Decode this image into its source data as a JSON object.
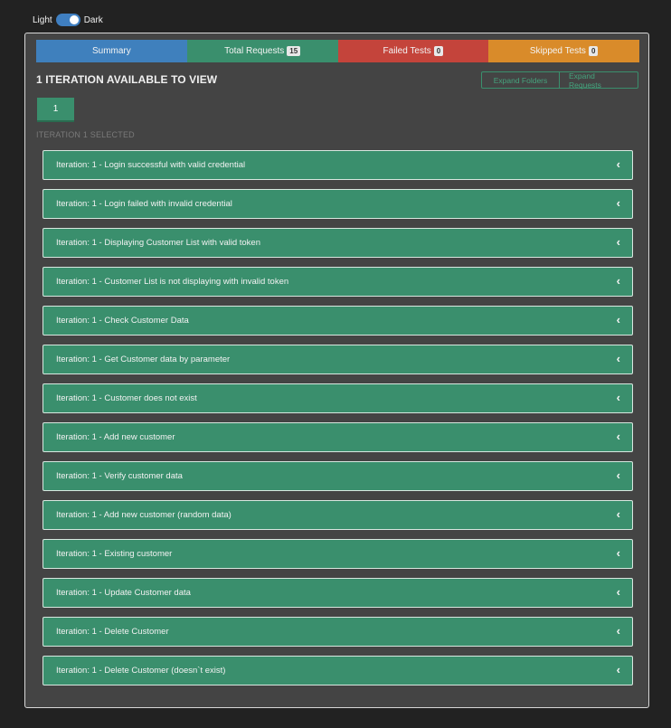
{
  "theme": {
    "light_label": "Light",
    "dark_label": "Dark"
  },
  "tabs": {
    "summary": "Summary",
    "total": "Total Requests",
    "total_count": "15",
    "failed": "Failed Tests",
    "failed_count": "0",
    "skipped": "Skipped Tests",
    "skipped_count": "0"
  },
  "heading": "1 ITERATION AVAILABLE TO VIEW",
  "expand": {
    "folders": "Expand Folders",
    "requests": "Expand Requests"
  },
  "iteration_button": "1",
  "iteration_selected": "ITERATION 1 SELECTED",
  "requests": [
    "Iteration: 1 - Login successful with valid credential",
    "Iteration: 1 - Login failed with invalid credential",
    "Iteration: 1 - Displaying Customer List with valid token",
    "Iteration: 1 - Customer List is not displaying with invalid token",
    "Iteration: 1 - Check Customer Data",
    "Iteration: 1 - Get Customer data by parameter",
    "Iteration: 1 - Customer does not exist",
    "Iteration: 1 - Add new customer",
    "Iteration: 1 - Verify customer data",
    "Iteration: 1 - Add new customer (random data)",
    "Iteration: 1 - Existing customer",
    "Iteration: 1 - Update Customer data",
    "Iteration: 1 - Delete Customer",
    "Iteration: 1 - Delete Customer (doesn`t exist)"
  ],
  "colors": {
    "summary": "#3f80bd",
    "total": "#3a8f6d",
    "failed": "#c4443b",
    "skipped": "#d98b2a"
  },
  "icons": {
    "request_toggle": "chevron-left-icon"
  }
}
